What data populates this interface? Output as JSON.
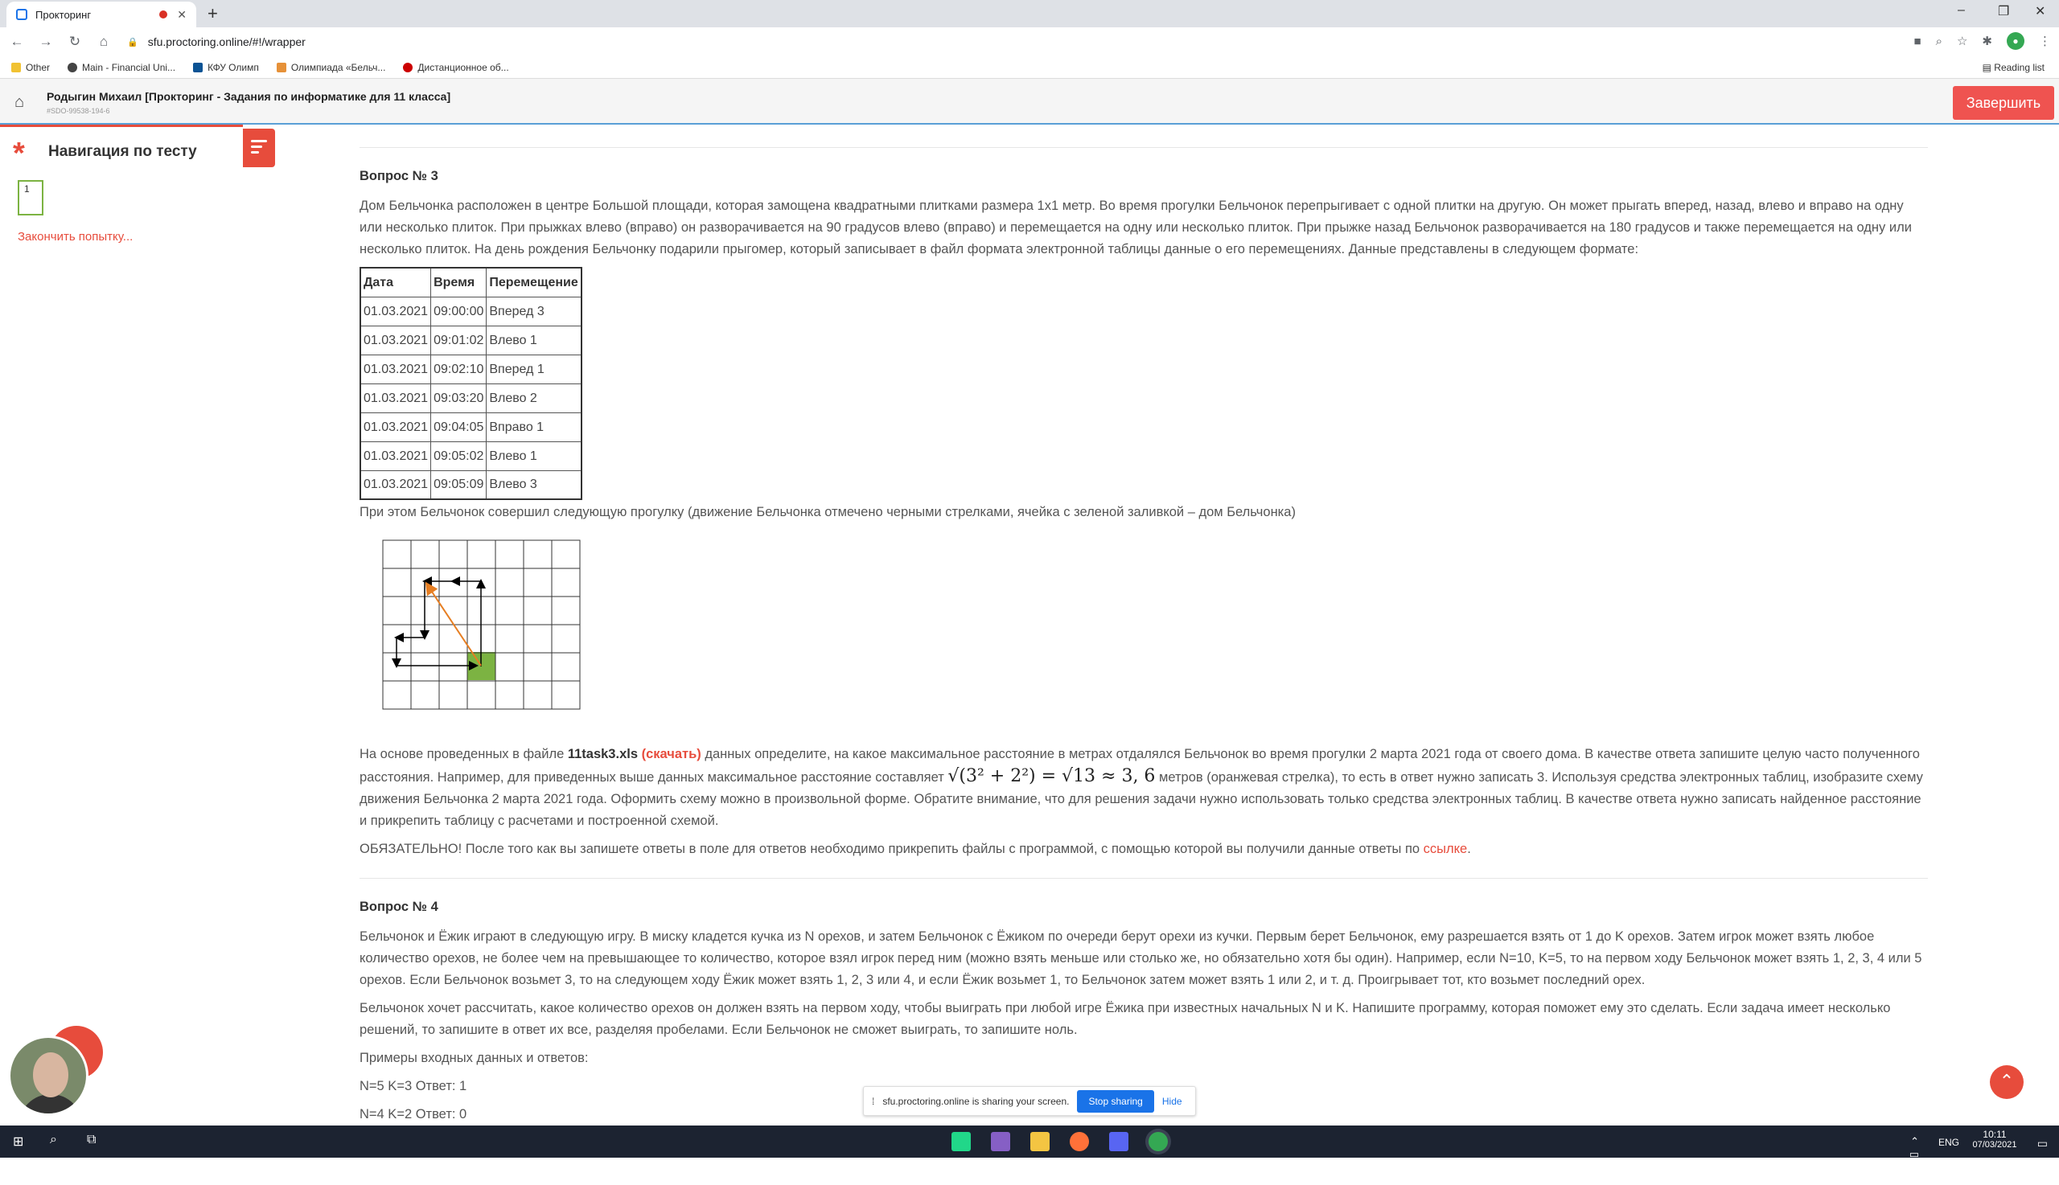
{
  "browser": {
    "tab_title": "Прокторинг",
    "url": "sfu.proctoring.online/#!/wrapper",
    "bookmarks": [
      "Other",
      "Main - Financial Uni...",
      "КФУ Олимп",
      "Олимпиада «Бельч...",
      "Дистанционное об..."
    ],
    "reading_list": "Reading list"
  },
  "header": {
    "title": "Родыгин Михаил [Прокторинг - Задания по информатике для 11 класса]",
    "subtitle": "#SDO-99538-194-6",
    "finish_button": "Завершить"
  },
  "sidebar": {
    "title": "Навигация по тесту",
    "question_number": "1",
    "end_attempt": "Закончить попытку..."
  },
  "question3": {
    "title": "Вопрос № 3",
    "intro": "Дом Бельчонка расположен в центре Большой площади, которая замощена квадратными плитками размера 1х1 метр. Во время прогулки Бельчонок перепрыгивает с одной плитки на другую. Он может прыгать вперед, назад, влево и вправо на одну или несколько плиток. При прыжках влево (вправо) он разворачивается на 90 градусов влево (вправо) и перемещается на одну или несколько плиток. При прыжке назад Бельчонок разворачивается на 180 градусов и также перемещается на одну или несколько плиток. На день рождения Бельчонку подарили прыгомер, который записывает в файл формата электронной таблицы данные о его перемещениях. Данные представлены в следующем формате:",
    "table_headers": [
      "Дата",
      "Время",
      "Перемещение"
    ],
    "table_rows": [
      [
        "01.03.2021",
        "09:00:00",
        "Вперед 3"
      ],
      [
        "01.03.2021",
        "09:01:02",
        "Влево 1"
      ],
      [
        "01.03.2021",
        "09:02:10",
        "Вперед 1"
      ],
      [
        "01.03.2021",
        "09:03:20",
        "Влево 2"
      ],
      [
        "01.03.2021",
        "09:04:05",
        "Вправо 1"
      ],
      [
        "01.03.2021",
        "09:05:02",
        "Влево 1"
      ],
      [
        "01.03.2021",
        "09:05:09",
        "Влево 3"
      ]
    ],
    "walk_text": "При этом Бельчонок совершил следующую прогулку (движение Бельчонка отмечено черными стрелками, ячейка с зеленой заливкой – дом Бельчонка)",
    "body_pre": "На основе проведенных в файле ",
    "filename": "11task3.xls",
    "download_link": "(скачать)",
    "body_mid": " данных определите, на какое максимальное расстояние в метрах отдалялся Бельчонок во время прогулки 2 марта 2021 года от своего дома. В качестве ответа запишите целую часто полученного расстояния. Например, для приведенных выше данных максимальное расстояние составляет ",
    "formula": "√(3² + 2²) = √13 ≈ 3, 6",
    "body_post": " метров (оранжевая стрелка), то есть в ответ нужно записать 3. Используя средства электронных таблиц, изобразите схему движения Бельчонка 2 марта 2021 года. Оформить схему можно в произвольной форме. Обратите внимание, что для решения задачи нужно использовать только средства электронных таблиц. В качестве ответа нужно записать найденное расстояние и прикрепить таблицу с расчетами и построенной схемой.",
    "mandatory_pre": "ОБЯЗАТЕЛЬНО! После того как вы запишете ответы в поле для ответов необходимо прикрепить файлы с программой, с помощью которой вы получили данные ответы по ",
    "mandatory_link": "ссылке",
    "mandatory_post": "."
  },
  "question4": {
    "title": "Вопрос № 4",
    "p1": "Бельчонок и Ёжик играют в следующую игру. В миску кладется кучка из N орехов, и затем Бельчонок с Ёжиком по очереди берут орехи из кучки. Первым берет Бельчонок, ему разрешается взять от 1 до K орехов. Затем игрок может взять любое количество орехов, не более чем на  превышающее то количество, которое взял игрок перед ним (можно взять меньше или столько же, но обязательно хотя бы один). Например, если N=10, K=5, то на первом ходу Бельчонок может взять 1, 2, 3, 4 или 5 орехов. Если Бельчонок возьмет 3, то на следующем ходу Ёжик может взять 1, 2, 3 или 4, и если Ёжик возьмет 1, то Бельчонок затем может взять 1 или 2, и т. д. Проигрывает тот, кто возьмет последний орех.",
    "p2": "Бельчонок хочет рассчитать, какое количество орехов он должен взять на первом ходу, чтобы выиграть при любой игре Ёжика при известных начальных N и K. Напишите программу, которая поможет ему это сделать. Если задача имеет несколько решений, то запишите в ответ их все, разделяя пробелами. Если Бельчонок не сможет выиграть, то запишите ноль.",
    "examples_title": "Примеры входных данных и ответов:",
    "ex1": "N=5 K=3 Ответ: 1",
    "ex2": "N=4 K=2 Ответ: 0"
  },
  "share_bar": {
    "text": "sfu.proctoring.online is sharing your screen.",
    "stop": "Stop sharing",
    "hide": "Hide"
  },
  "taskbar": {
    "lang": "ENG",
    "time": "10:11",
    "date": "07/03/2021"
  },
  "colors": {
    "accent": "#e74c3c",
    "home_cell": "#7cb342",
    "orange_arrow": "#e67e22"
  }
}
